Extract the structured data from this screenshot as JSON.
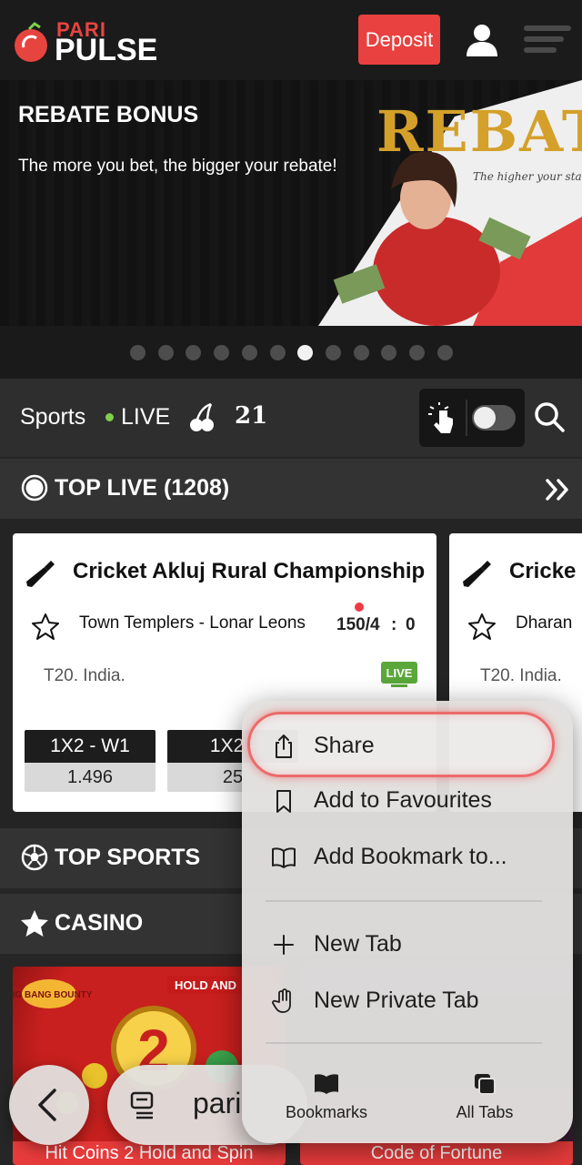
{
  "header": {
    "logo_top": "PARI",
    "logo_bottom": "PULSE",
    "deposit_label": "Deposit"
  },
  "banner": {
    "title": "REBATE BONUS",
    "subtitle": "The more you bet, the bigger your rebate!",
    "art_text": "REBATE",
    "art_script": "The higher your stake, the larger your rebate!",
    "carousel": {
      "total": 12,
      "active": 7
    }
  },
  "sports_bar": {
    "sports_label": "Sports",
    "live_label": "LIVE",
    "count": "21",
    "toggle_on": false
  },
  "top_live": {
    "title": "TOP LIVE (1208)"
  },
  "matches": [
    {
      "title": "Cricket Akluj Rural Championship",
      "teams": "Town Templers - Lonar Leons",
      "score_a": "150/4",
      "score_sep": ":",
      "score_b": "0",
      "league": "T20. India.",
      "odds": [
        {
          "label": "1X2 - W1",
          "value": "1.496"
        },
        {
          "label": "1X2 -",
          "value": "25"
        }
      ]
    },
    {
      "title": "Cricke",
      "teams": "Dharan",
      "league": "T20. India."
    }
  ],
  "top_sports": {
    "title": "TOP SPORTS"
  },
  "casino": {
    "title": "CASINO",
    "games": [
      {
        "label": "Hit Coins 2 Hold and Spin",
        "art_a": "BIG BANG BOUNTY",
        "art_b": "HOLD AND",
        "art_c": "2"
      },
      {
        "label": "Code of Fortune"
      }
    ]
  },
  "context_menu": {
    "items": [
      {
        "label": "Share",
        "icon": "share-icon"
      },
      {
        "label": "Add to Favourites",
        "icon": "bookmark-icon"
      },
      {
        "label": "Add Bookmark to...",
        "icon": "book-icon"
      },
      {
        "label": "New Tab",
        "icon": "plus-icon"
      },
      {
        "label": "New Private Tab",
        "icon": "hand-icon"
      }
    ],
    "bottom": [
      {
        "label": "Bookmarks",
        "icon": "book-filled-icon"
      },
      {
        "label": "All Tabs",
        "icon": "tabs-icon"
      }
    ]
  },
  "browser_bar": {
    "url_text": "pari"
  },
  "colors": {
    "brand_red": "#e8413f",
    "live_green": "#7fd04a",
    "menu_bg": "#e2e0de"
  }
}
